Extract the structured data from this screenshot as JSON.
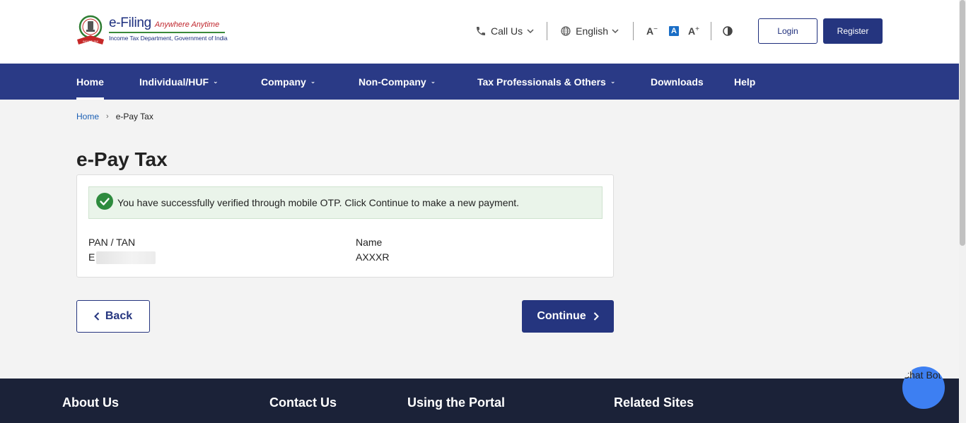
{
  "header": {
    "logo_title": "e-Filing",
    "logo_tagline": "Anywhere Anytime",
    "logo_subtitle": "Income Tax Department, Government of India",
    "call_us": "Call Us",
    "language": "English",
    "font_decrease": "A",
    "font_normal": "A",
    "font_increase": "A",
    "login_label": "Login",
    "register_label": "Register"
  },
  "nav": {
    "items": [
      {
        "label": "Home",
        "active": true
      },
      {
        "label": "Individual/HUF",
        "dropdown": true
      },
      {
        "label": "Company",
        "dropdown": true
      },
      {
        "label": "Non-Company",
        "dropdown": true
      },
      {
        "label": "Tax Professionals & Others",
        "dropdown": true
      },
      {
        "label": "Downloads"
      },
      {
        "label": "Help"
      }
    ]
  },
  "breadcrumb": {
    "home": "Home",
    "current": "e-Pay Tax"
  },
  "page": {
    "title": "e-Pay Tax",
    "alert": "You have successfully verified through mobile OTP. Click Continue to make a new payment.",
    "pan_label": "PAN / TAN",
    "pan_value": "E",
    "name_label": "Name",
    "name_value": "AXXXR",
    "back_label": "Back",
    "continue_label": "Continue"
  },
  "footer": {
    "about": "About Us",
    "contact": "Contact Us",
    "portal": "Using the Portal",
    "related": "Related Sites"
  },
  "chatbot": {
    "alt": "Chat Bot"
  },
  "colors": {
    "primary": "#25357f",
    "nav_bg": "#2a3a86",
    "success": "#2e8b3e",
    "footer_bg": "#1b2238",
    "chatbot": "#3d7ff2"
  }
}
